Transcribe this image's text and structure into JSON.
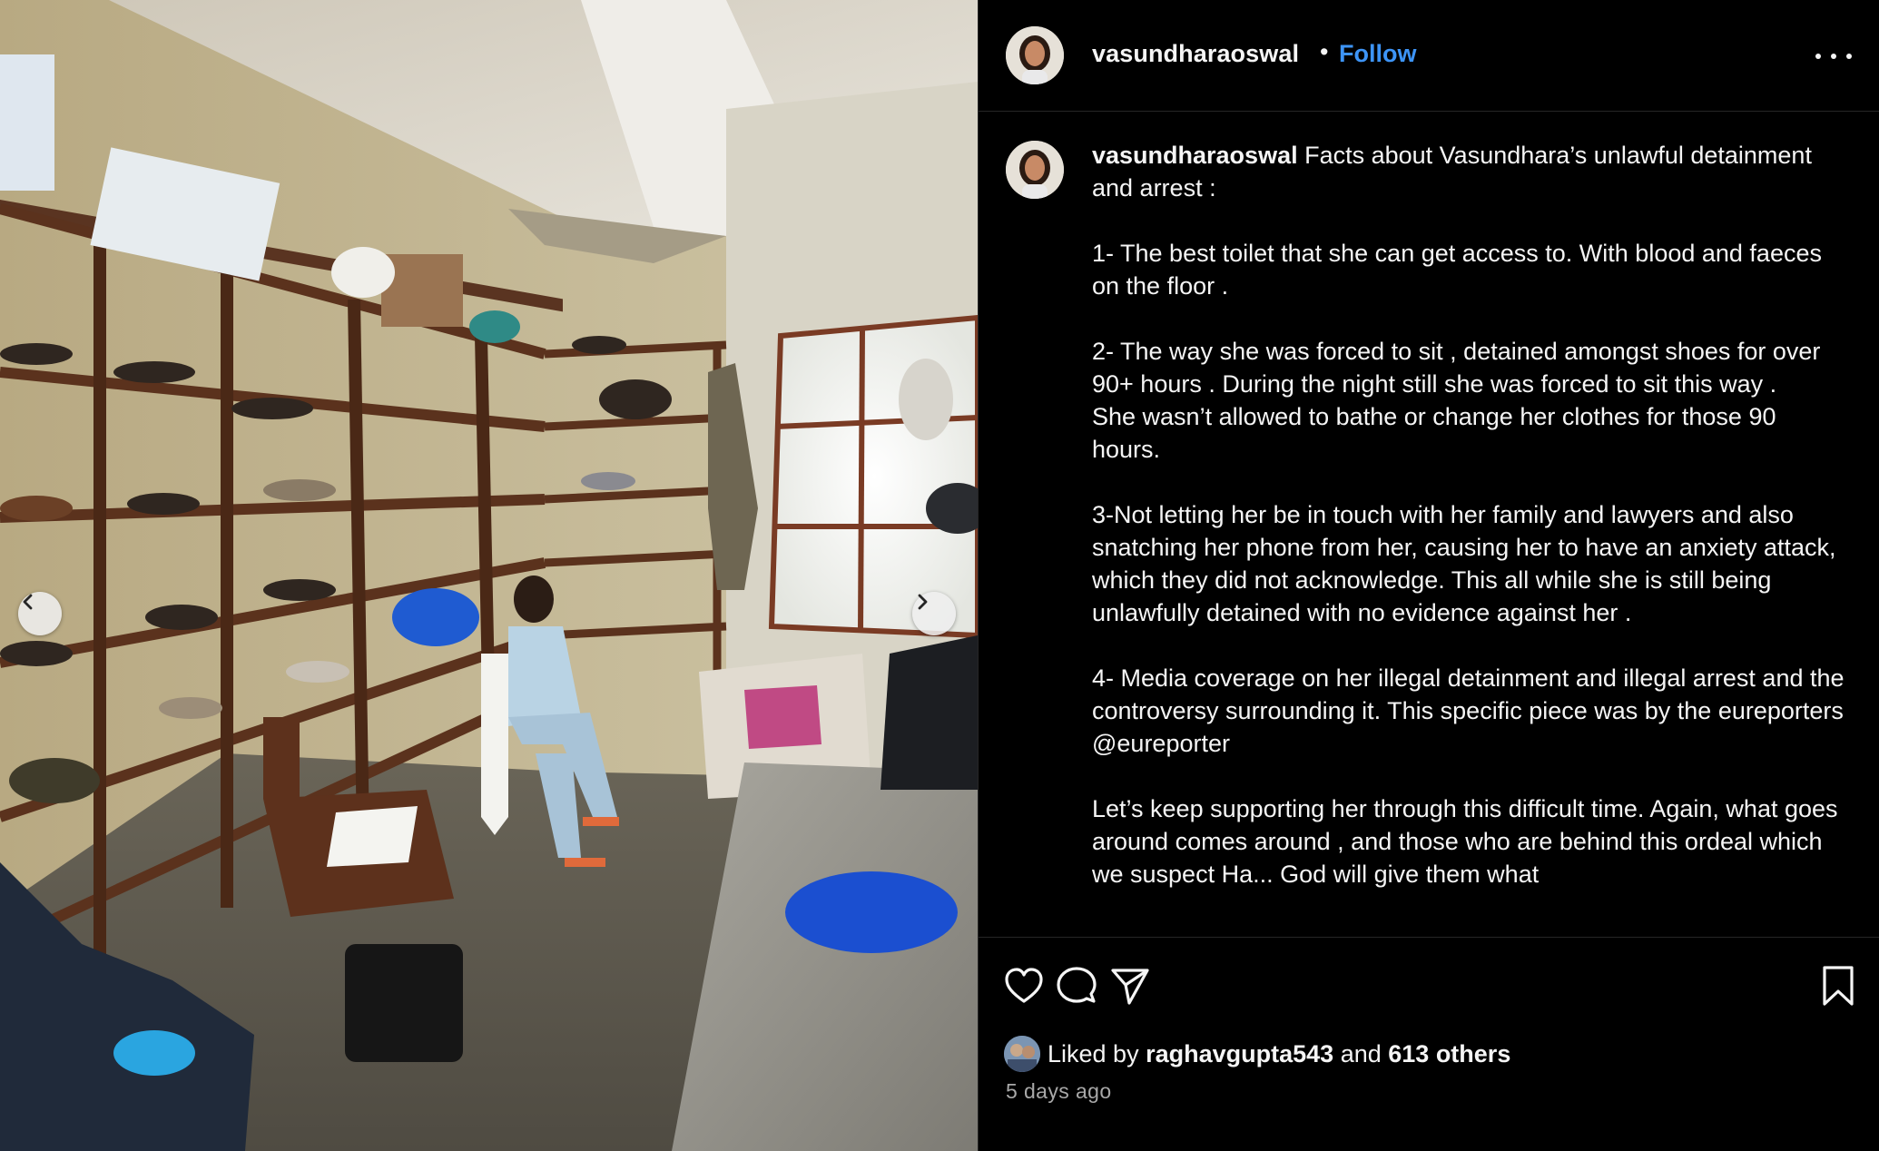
{
  "post": {
    "username": "vasundharaoswal",
    "follow_label": "Follow",
    "separator": "•",
    "caption_username": "vasundharaoswal",
    "caption_text": " Facts about Vasundhara’s unlawful detainment and arrest :\n\n1- The best toilet that she can get access to. With blood and faeces on the floor .\n\n2- The way she was forced to sit , detained amongst shoes for over 90+ hours . During the night still she was forced to sit this way .\nShe wasn’t allowed to bathe or change her clothes for those 90 hours.\n\n3-Not letting her be in touch with her family and lawyers and also snatching her phone from her, causing her to have an anxiety attack, which they did not acknowledge. This all while she is still being unlawfully detained with no evidence against her .\n\n4- Media coverage on her illegal detainment and illegal arrest and the controversy surrounding it. This specific piece was by the eureporters @eureporter\n\nLet’s keep supporting her through this difficult time. Again, what goes around comes around , and those who are behind this ordeal which we suspect Ha... God will give them what",
    "likes": {
      "prefix": "Liked by",
      "liker": "raghavgupta543",
      "joiner": "and",
      "others": "613 others"
    },
    "timestamp": "5 days ago"
  },
  "icons": {
    "prev": "chevron-left-icon",
    "next": "chevron-right-icon",
    "more": "more-horizontal-icon",
    "like": "heart-icon",
    "comment": "comment-icon",
    "share": "send-icon",
    "save": "bookmark-icon"
  },
  "colors": {
    "background": "#000000",
    "text": "#f5f5f5",
    "link": "#3d94f6",
    "muted": "#a8a8a8",
    "divider": "#262626"
  }
}
